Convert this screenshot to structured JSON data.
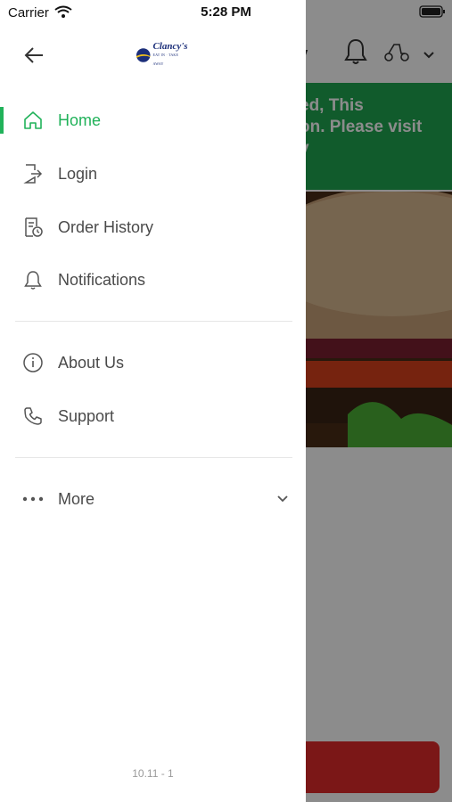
{
  "status_bar": {
    "carrier": "Carrier",
    "time": "5:28 PM"
  },
  "drawer": {
    "logo_text": "Clancy's",
    "logo_sub": "EAT IN · TAKE AWAY",
    "nav_items": [
      {
        "label": "Home",
        "icon": "home-icon",
        "active": true
      },
      {
        "label": "Login",
        "icon": "login-icon",
        "active": false
      },
      {
        "label": "Order History",
        "icon": "order-history-icon",
        "active": false
      },
      {
        "label": "Notifications",
        "icon": "bell-icon",
        "active": false
      }
    ],
    "info_items": [
      {
        "label": "About Us",
        "icon": "info-icon"
      },
      {
        "label": "Support",
        "icon": "phone-icon"
      }
    ],
    "more_label": "More",
    "version": "10.11 - 1"
  },
  "background": {
    "title_fragment": "ay",
    "banner_lines": [
      "ed, This",
      "on. Please visit",
      "y"
    ]
  },
  "colors": {
    "accent": "#21b25a",
    "banner": "#1fa650",
    "cta": "#e02a2a"
  }
}
